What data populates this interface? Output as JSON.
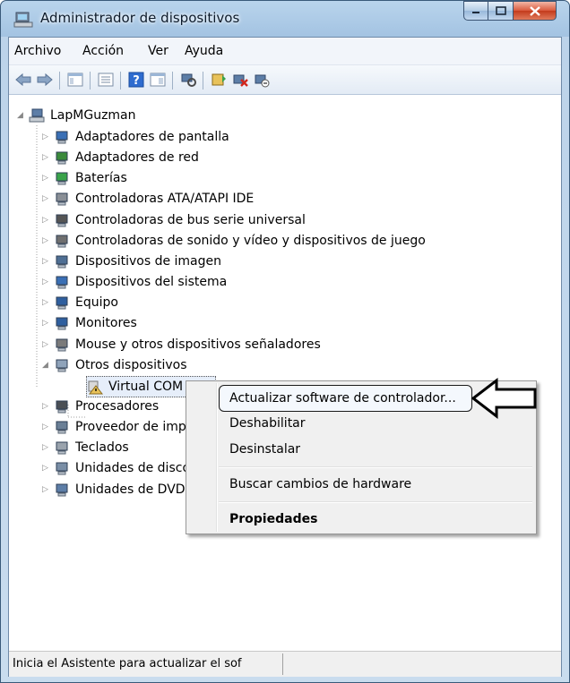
{
  "window": {
    "title": "Administrador de dispositivos",
    "icon": "device-manager-icon"
  },
  "menubar": {
    "items": [
      {
        "label": "Archivo"
      },
      {
        "label": "Acción"
      },
      {
        "label": "Ver"
      },
      {
        "label": "Ayuda"
      }
    ]
  },
  "toolbar": {
    "icons": [
      "back-icon",
      "forward-icon",
      "properties-pane-icon",
      "console-tree-icon",
      "help-icon",
      "view-icon",
      "scan-hardware-icon",
      "update-driver-icon",
      "uninstall-icon",
      "disable-icon"
    ]
  },
  "tree": {
    "root": {
      "label": "LapMGuzman",
      "icon": "computer-icon"
    },
    "nodes": [
      {
        "label": "Adaptadores de pantalla",
        "icon": "display-adapter-icon"
      },
      {
        "label": "Adaptadores de red",
        "icon": "network-adapter-icon"
      },
      {
        "label": "Baterías",
        "icon": "battery-icon"
      },
      {
        "label": "Controladoras ATA/ATAPI IDE",
        "icon": "ide-controller-icon"
      },
      {
        "label": "Controladoras de bus serie universal",
        "icon": "usb-icon"
      },
      {
        "label": "Controladoras de sonido y vídeo y dispositivos de juego",
        "icon": "speaker-icon"
      },
      {
        "label": "Dispositivos de imagen",
        "icon": "camera-icon"
      },
      {
        "label": "Dispositivos del sistema",
        "icon": "system-device-icon"
      },
      {
        "label": "Equipo",
        "icon": "computer-monitor-icon"
      },
      {
        "label": "Monitores",
        "icon": "monitor-icon"
      },
      {
        "label": "Mouse y otros dispositivos señaladores",
        "icon": "mouse-icon"
      },
      {
        "label": "Otros dispositivos",
        "icon": "unknown-device-icon"
      },
      {
        "label": "Virtual COM Port",
        "icon": "warning-device-icon"
      },
      {
        "label": "Procesadores",
        "icon": "processor-icon"
      },
      {
        "label": "Proveedor de impresión WSD",
        "icon": "printer-icon"
      },
      {
        "label": "Teclados",
        "icon": "keyboard-icon"
      },
      {
        "label": "Unidades de disco",
        "icon": "disk-drive-icon"
      },
      {
        "label": "Unidades de DVD o CD-ROM",
        "icon": "dvd-drive-icon"
      }
    ]
  },
  "context_menu": {
    "items": [
      {
        "label": "Actualizar software de controlador..."
      },
      {
        "label": "Deshabilitar"
      },
      {
        "label": "Desinstalar"
      },
      {
        "label": "Buscar cambios de hardware"
      },
      {
        "label": "Propiedades"
      }
    ]
  },
  "statusbar": {
    "text": "Inicia el Asistente para actualizar el sof"
  },
  "colors": {
    "frame": "#a3c3e2",
    "close_button": "#c33b1c",
    "warning": "#f5c518"
  }
}
